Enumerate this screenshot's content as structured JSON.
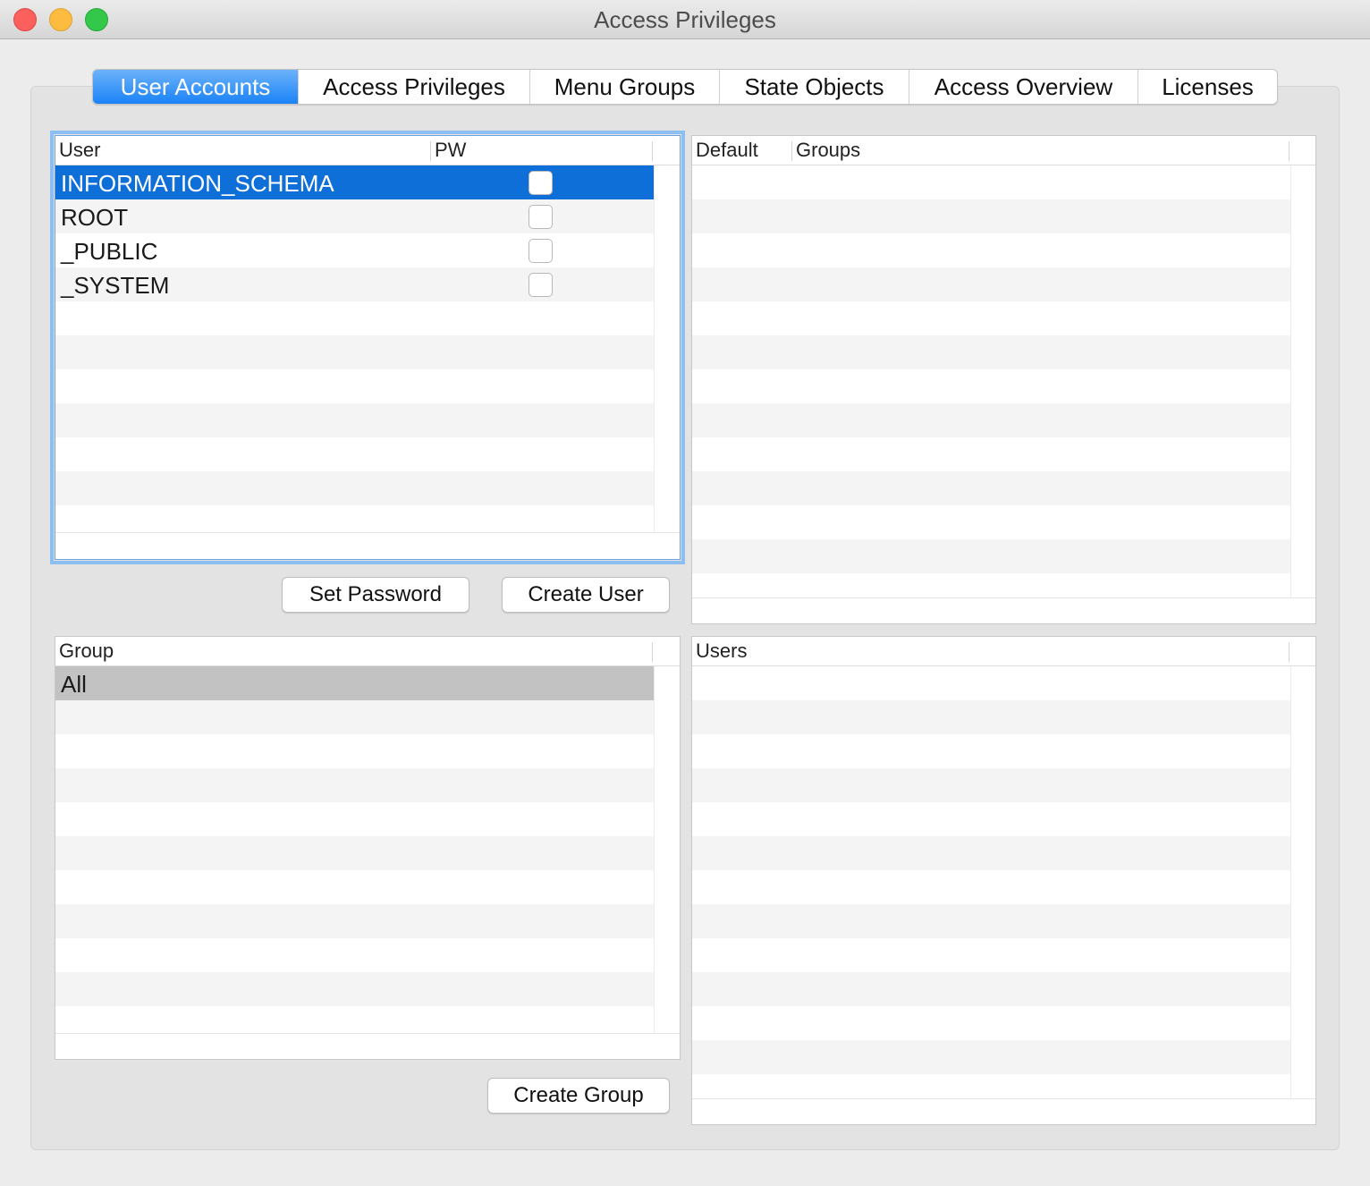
{
  "window": {
    "title": "Access Privileges"
  },
  "tabs": [
    {
      "label": "User Accounts",
      "active": true
    },
    {
      "label": "Access Privileges",
      "active": false
    },
    {
      "label": "Menu Groups",
      "active": false
    },
    {
      "label": "State Objects",
      "active": false
    },
    {
      "label": "Access Overview",
      "active": false
    },
    {
      "label": "Licenses",
      "active": false
    }
  ],
  "users_table": {
    "columns": {
      "user": "User",
      "pw": "PW"
    },
    "rows": [
      {
        "user": "INFORMATION_SCHEMA",
        "pw": false,
        "selected": true
      },
      {
        "user": "ROOT",
        "pw": false,
        "selected": false
      },
      {
        "user": "_PUBLIC",
        "pw": false,
        "selected": false
      },
      {
        "user": "_SYSTEM",
        "pw": false,
        "selected": false
      }
    ]
  },
  "user_groups_table": {
    "columns": {
      "default": "Default",
      "groups": "Groups"
    },
    "rows": []
  },
  "buttons": {
    "set_password": "Set Password",
    "create_user": "Create User",
    "create_group": "Create Group"
  },
  "groups_table": {
    "columns": {
      "group": "Group"
    },
    "rows": [
      {
        "group": "All",
        "selected": true
      }
    ]
  },
  "group_users_table": {
    "columns": {
      "users": "Users"
    },
    "rows": []
  },
  "colors": {
    "selection": "#0f6fd9",
    "tab_active": "#1a82f6",
    "focus_ring": "#8dbef2",
    "inactive_selection": "#c2c2c2"
  }
}
